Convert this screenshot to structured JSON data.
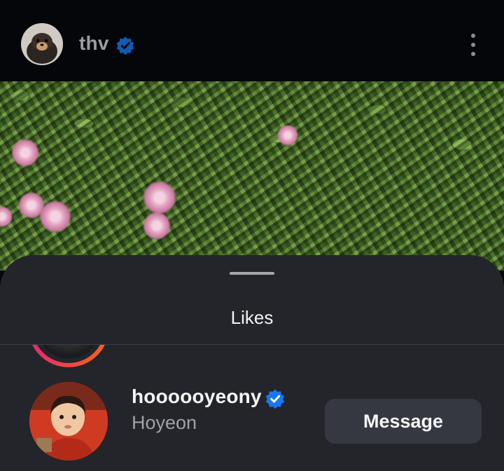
{
  "header": {
    "username": "thv",
    "verified_icon": "verified-badge-icon",
    "more_icon": "more-vertical-icon"
  },
  "sheet": {
    "title": "Likes"
  },
  "likes": [
    {
      "username": "hoooooyeony",
      "display_name": "Hoyeon",
      "verified": true,
      "button_label": "Message"
    }
  ],
  "colors": {
    "verified_blue": "#1877F2",
    "sheet_bg": "#23252B",
    "button_bg": "#353841"
  }
}
